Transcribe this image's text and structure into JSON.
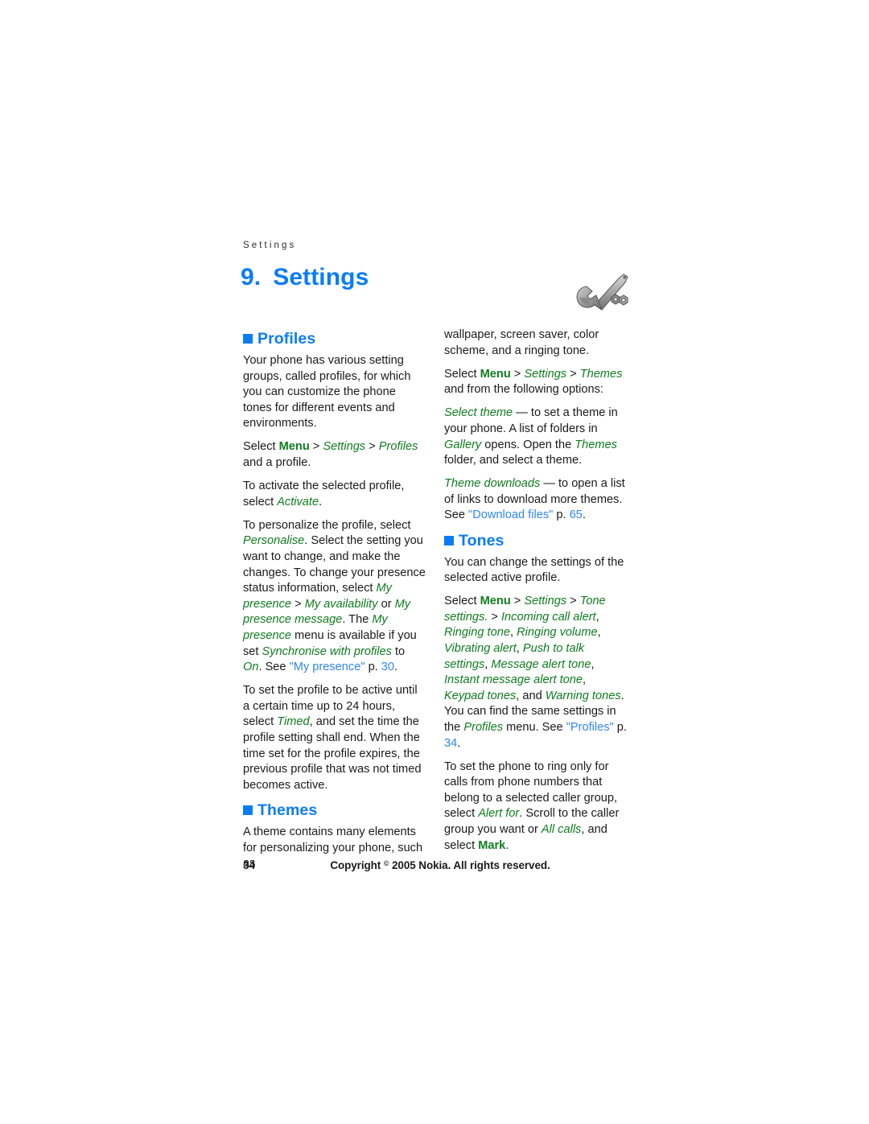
{
  "running_header": "Settings",
  "chapter": {
    "number": "9.",
    "title": "Settings",
    "icon": "wrench-and-nuts-icon"
  },
  "colors": {
    "heading_blue": "#0a7cf5",
    "menu_green": "#0e7c1e",
    "xref_blue": "#2f86f2",
    "body_black": "#1a1a1a"
  },
  "left_column": {
    "profiles_heading": "Profiles",
    "p1": "Your phone has various setting groups, called profiles, for which you can customize the phone tones for different events and environments.",
    "p2": {
      "select": "Select ",
      "menu": "Menu",
      "sep1": " > ",
      "settings": "Settings",
      "sep2": " > ",
      "profiles": "Profiles",
      "tail": " and a profile."
    },
    "p3": {
      "lead": "To activate the selected profile, select ",
      "activate": "Activate",
      "tail": "."
    },
    "p4": {
      "lead": "To personalize the profile, select ",
      "personalise": "Personalise",
      "mid1": ". Select the setting you want to change, and make the changes. To change your presence status information, select ",
      "my_presence": "My presence",
      "sep1": " > ",
      "my_availability": "My availability",
      "or": " or ",
      "my_presence_message": "My presence message",
      "mid2": ". The ",
      "my_presence2": "My presence",
      "mid3": " menu is available if you set ",
      "synchronise": "Synchronise with profiles",
      "to": " to ",
      "on": "On",
      "mid4": ". See ",
      "xref": "\"My presence\"",
      "page_lead": " p. ",
      "page": "30",
      "tail": "."
    },
    "p5": {
      "lead": "To set the profile to be active until a certain time up to 24 hours, select ",
      "timed": "Timed",
      "tail": ", and set the time the profile setting shall end. When the time set for the profile expires, the previous profile that was not timed becomes active."
    },
    "themes_heading": "Themes",
    "p6": "A theme contains many elements for personalizing your phone, such as"
  },
  "right_column": {
    "p1": "wallpaper, screen saver, color scheme, and a ringing tone.",
    "p2": {
      "select": "Select ",
      "menu": "Menu",
      "sep1": " > ",
      "settings": "Settings",
      "sep2": " > ",
      "themes": "Themes",
      "tail": " and from the following options:"
    },
    "p3": {
      "select_theme": "Select theme",
      "mid1": " — to set a theme in your phone. A list of folders in ",
      "gallery": "Gallery",
      "mid2": " opens. Open the ",
      "themes": "Themes",
      "tail": " folder, and select a theme."
    },
    "p4": {
      "theme_downloads": "Theme downloads",
      "mid1": " — to open a list of links to download more themes. See ",
      "xref": "\"Download files\"",
      "page_lead": " p. ",
      "page": "65",
      "tail": "."
    },
    "tones_heading": "Tones",
    "p5": "You can change the settings of the selected active profile.",
    "p6": {
      "select": "Select ",
      "menu": "Menu",
      "sep1": " > ",
      "settings": "Settings",
      "sep2": " > ",
      "tone_settings": "Tone settings.",
      "sep3": " > ",
      "items": [
        "Incoming call alert",
        "Ringing tone",
        "Ringing volume",
        "Vibrating alert",
        "Push to talk settings",
        "Message alert tone",
        "Instant message alert tone",
        "Keypad tones"
      ],
      "and": ", and ",
      "warning_tones": "Warning tones",
      "mid": ". You can find the same settings in the ",
      "profiles": "Profiles",
      "mid2": " menu. See ",
      "xref": "\"Profiles\"",
      "page_lead": " p. ",
      "page": "34",
      "tail": "."
    },
    "p7": {
      "lead": "To set the phone to ring only for calls from phone numbers that belong to a selected caller group, select ",
      "alert_for": "Alert for",
      "mid1": ". Scroll to the caller group you want or ",
      "all_calls": "All calls",
      "mid2": ", and select ",
      "mark": "Mark",
      "tail": "."
    }
  },
  "footer": {
    "page_number": "34",
    "copyright_pre": "Copyright ",
    "copyright_symbol": "©",
    "copyright_post": " 2005 Nokia. All rights reserved."
  }
}
